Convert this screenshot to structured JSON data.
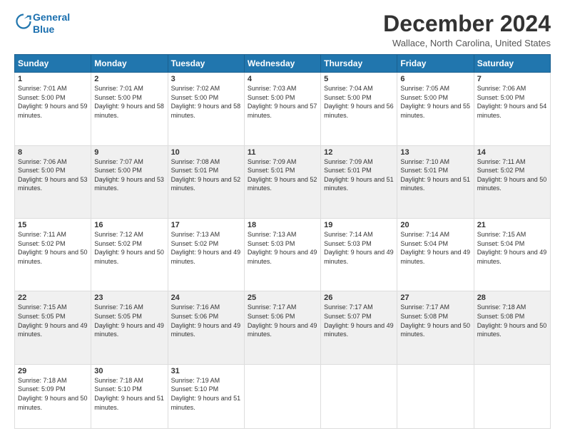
{
  "header": {
    "logo_line1": "General",
    "logo_line2": "Blue",
    "month": "December 2024",
    "location": "Wallace, North Carolina, United States"
  },
  "days_of_week": [
    "Sunday",
    "Monday",
    "Tuesday",
    "Wednesday",
    "Thursday",
    "Friday",
    "Saturday"
  ],
  "weeks": [
    [
      {
        "day": "1",
        "sunrise": "7:01 AM",
        "sunset": "5:00 PM",
        "daylight": "9 hours and 59 minutes."
      },
      {
        "day": "2",
        "sunrise": "7:01 AM",
        "sunset": "5:00 PM",
        "daylight": "9 hours and 58 minutes."
      },
      {
        "day": "3",
        "sunrise": "7:02 AM",
        "sunset": "5:00 PM",
        "daylight": "9 hours and 58 minutes."
      },
      {
        "day": "4",
        "sunrise": "7:03 AM",
        "sunset": "5:00 PM",
        "daylight": "9 hours and 57 minutes."
      },
      {
        "day": "5",
        "sunrise": "7:04 AM",
        "sunset": "5:00 PM",
        "daylight": "9 hours and 56 minutes."
      },
      {
        "day": "6",
        "sunrise": "7:05 AM",
        "sunset": "5:00 PM",
        "daylight": "9 hours and 55 minutes."
      },
      {
        "day": "7",
        "sunrise": "7:06 AM",
        "sunset": "5:00 PM",
        "daylight": "9 hours and 54 minutes."
      }
    ],
    [
      {
        "day": "8",
        "sunrise": "7:06 AM",
        "sunset": "5:00 PM",
        "daylight": "9 hours and 53 minutes."
      },
      {
        "day": "9",
        "sunrise": "7:07 AM",
        "sunset": "5:00 PM",
        "daylight": "9 hours and 53 minutes."
      },
      {
        "day": "10",
        "sunrise": "7:08 AM",
        "sunset": "5:01 PM",
        "daylight": "9 hours and 52 minutes."
      },
      {
        "day": "11",
        "sunrise": "7:09 AM",
        "sunset": "5:01 PM",
        "daylight": "9 hours and 52 minutes."
      },
      {
        "day": "12",
        "sunrise": "7:09 AM",
        "sunset": "5:01 PM",
        "daylight": "9 hours and 51 minutes."
      },
      {
        "day": "13",
        "sunrise": "7:10 AM",
        "sunset": "5:01 PM",
        "daylight": "9 hours and 51 minutes."
      },
      {
        "day": "14",
        "sunrise": "7:11 AM",
        "sunset": "5:02 PM",
        "daylight": "9 hours and 50 minutes."
      }
    ],
    [
      {
        "day": "15",
        "sunrise": "7:11 AM",
        "sunset": "5:02 PM",
        "daylight": "9 hours and 50 minutes."
      },
      {
        "day": "16",
        "sunrise": "7:12 AM",
        "sunset": "5:02 PM",
        "daylight": "9 hours and 50 minutes."
      },
      {
        "day": "17",
        "sunrise": "7:13 AM",
        "sunset": "5:02 PM",
        "daylight": "9 hours and 49 minutes."
      },
      {
        "day": "18",
        "sunrise": "7:13 AM",
        "sunset": "5:03 PM",
        "daylight": "9 hours and 49 minutes."
      },
      {
        "day": "19",
        "sunrise": "7:14 AM",
        "sunset": "5:03 PM",
        "daylight": "9 hours and 49 minutes."
      },
      {
        "day": "20",
        "sunrise": "7:14 AM",
        "sunset": "5:04 PM",
        "daylight": "9 hours and 49 minutes."
      },
      {
        "day": "21",
        "sunrise": "7:15 AM",
        "sunset": "5:04 PM",
        "daylight": "9 hours and 49 minutes."
      }
    ],
    [
      {
        "day": "22",
        "sunrise": "7:15 AM",
        "sunset": "5:05 PM",
        "daylight": "9 hours and 49 minutes."
      },
      {
        "day": "23",
        "sunrise": "7:16 AM",
        "sunset": "5:05 PM",
        "daylight": "9 hours and 49 minutes."
      },
      {
        "day": "24",
        "sunrise": "7:16 AM",
        "sunset": "5:06 PM",
        "daylight": "9 hours and 49 minutes."
      },
      {
        "day": "25",
        "sunrise": "7:17 AM",
        "sunset": "5:06 PM",
        "daylight": "9 hours and 49 minutes."
      },
      {
        "day": "26",
        "sunrise": "7:17 AM",
        "sunset": "5:07 PM",
        "daylight": "9 hours and 49 minutes."
      },
      {
        "day": "27",
        "sunrise": "7:17 AM",
        "sunset": "5:08 PM",
        "daylight": "9 hours and 50 minutes."
      },
      {
        "day": "28",
        "sunrise": "7:18 AM",
        "sunset": "5:08 PM",
        "daylight": "9 hours and 50 minutes."
      }
    ],
    [
      {
        "day": "29",
        "sunrise": "7:18 AM",
        "sunset": "5:09 PM",
        "daylight": "9 hours and 50 minutes."
      },
      {
        "day": "30",
        "sunrise": "7:18 AM",
        "sunset": "5:10 PM",
        "daylight": "9 hours and 51 minutes."
      },
      {
        "day": "31",
        "sunrise": "7:19 AM",
        "sunset": "5:10 PM",
        "daylight": "9 hours and 51 minutes."
      },
      null,
      null,
      null,
      null
    ]
  ],
  "labels": {
    "sunrise": "Sunrise:",
    "sunset": "Sunset:",
    "daylight": "Daylight:"
  }
}
